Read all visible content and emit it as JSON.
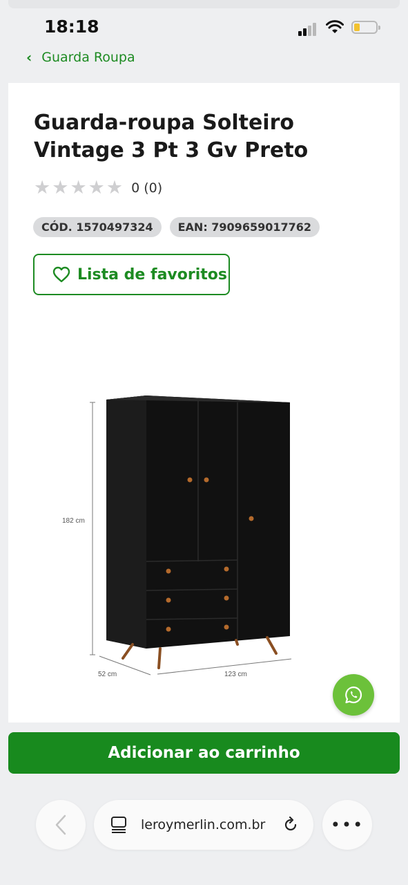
{
  "status_bar": {
    "time": "18:18"
  },
  "breadcrumb": {
    "label": "Guarda Roupa"
  },
  "product": {
    "title": "Guarda-roupa Solteiro Vintage 3 Pt 3 Gv Preto",
    "rating_text": "0 (0)",
    "rating_value": 0,
    "rating_max": 5,
    "code_tag": "CÓD. 1570497324",
    "ean_tag": "EAN: 7909659017762",
    "favorites_label": "Lista de favoritos",
    "dimensions": {
      "height": "182 cm",
      "depth": "52 cm",
      "width": "123 cm"
    }
  },
  "cart": {
    "add_label": "Adicionar ao carrinho"
  },
  "browser": {
    "url": "leroymerlin.com.br"
  },
  "colors": {
    "brand_green": "#188a1e",
    "link_green": "#1d8b22",
    "whatsapp_green": "#6cc13a"
  },
  "icons": [
    "chevron-left-icon",
    "star-icon",
    "heart-icon",
    "whatsapp-icon",
    "back-arrow-icon",
    "tabs-icon",
    "reload-icon",
    "more-icon"
  ]
}
